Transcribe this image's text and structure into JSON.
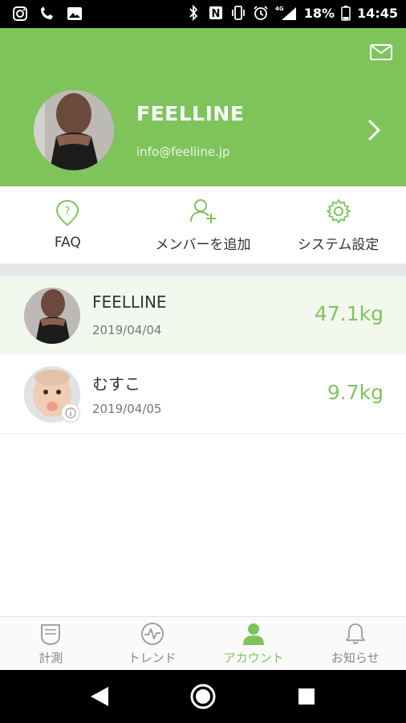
{
  "status_bar": {
    "network": "4G",
    "battery_percent": "18%",
    "time": "14:45"
  },
  "profile": {
    "name": "FEELLINE",
    "email": "info@feelline.jp"
  },
  "menu": {
    "items": [
      {
        "label": "FAQ",
        "icon": "question-icon"
      },
      {
        "label": "メンバーを追加",
        "icon": "add-user-icon"
      },
      {
        "label": "システム設定",
        "icon": "gear-icon"
      }
    ]
  },
  "members": [
    {
      "name": "FEELLINE",
      "date": "2019/04/04",
      "weight": "47.1kg",
      "selected": true
    },
    {
      "name": "むすこ",
      "date": "2019/04/05",
      "weight": "9.7kg",
      "selected": false
    }
  ],
  "bottom_nav": {
    "items": [
      {
        "label": "計測",
        "icon": "scale-icon",
        "active": false
      },
      {
        "label": "トレンド",
        "icon": "trend-icon",
        "active": false
      },
      {
        "label": "アカウント",
        "icon": "account-icon",
        "active": true
      },
      {
        "label": "お知らせ",
        "icon": "bell-icon",
        "active": false
      }
    ]
  },
  "colors": {
    "accent": "#7ec45b",
    "selected_row": "#f2f8ee"
  }
}
